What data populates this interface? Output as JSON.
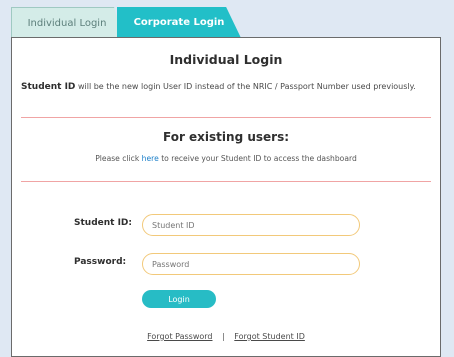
{
  "tabs": {
    "individual": "Individual Login",
    "corporate": "Corporate Login"
  },
  "card": {
    "title": "Individual Login",
    "notice_bold": "Student ID",
    "notice_rest": "will be the new login User ID instead of the NRIC / Passport Number used previously.",
    "existing_title": "For existing users:",
    "existing_pre": "Please click",
    "existing_link": "here",
    "existing_post": "to receive your Student ID to access the dashboard"
  },
  "form": {
    "student_id_label": "Student ID:",
    "student_id_placeholder": "Student ID",
    "password_label": "Password:",
    "password_placeholder": "Password",
    "login_label": "Login"
  },
  "links": {
    "forgot_password": "Forgot Password",
    "separator": "|",
    "forgot_student_id": "Forgot Student ID"
  },
  "colors": {
    "accent": "#27bcc5",
    "divider": "#f0a4a4",
    "input_border": "#f2c97a",
    "link": "#1b7fc9"
  }
}
